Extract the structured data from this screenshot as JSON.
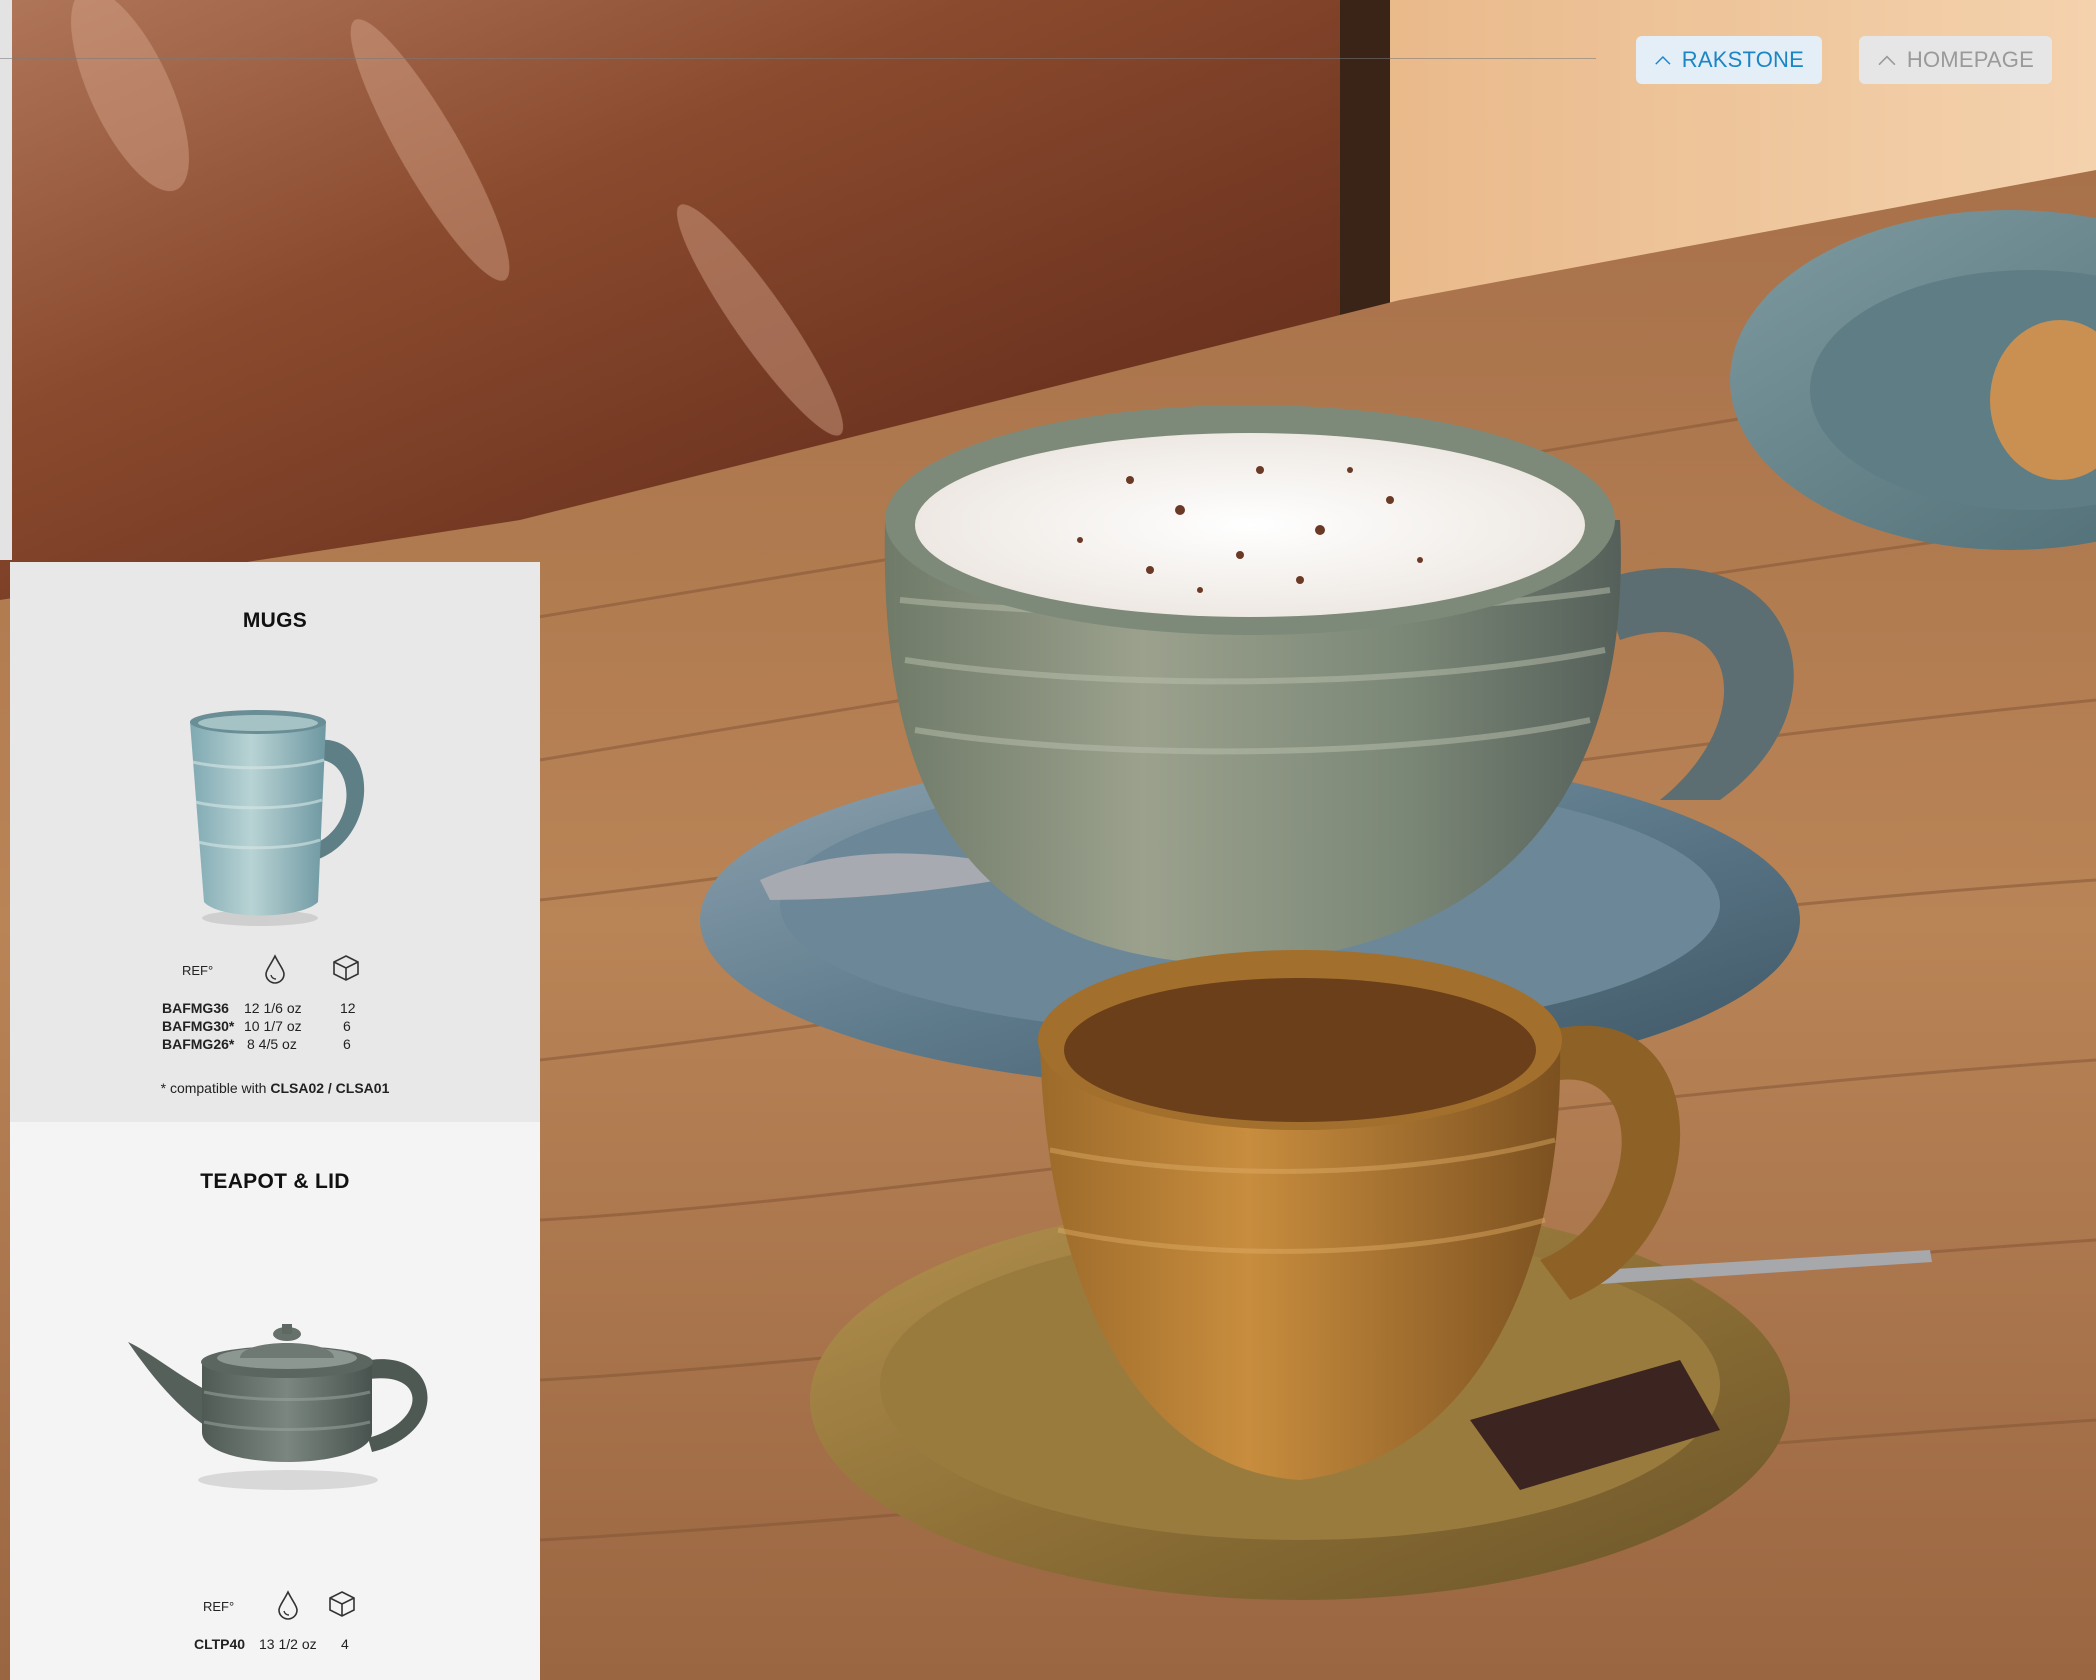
{
  "nav": {
    "rakstone_label": "RAKSTONE",
    "homepage_label": "HOMEPAGE",
    "arrow_icon": "chevron-up-icon"
  },
  "colors": {
    "accent": "#1a86c7",
    "muted": "#9a9a9a"
  },
  "mugs": {
    "title": "MUGS",
    "ref_label": "REF°",
    "capacity_icon": "drop-icon",
    "pack_icon": "box-icon",
    "rows": [
      {
        "code": "BAFMG36",
        "capacity": "12 1/6 oz",
        "qty": "12"
      },
      {
        "code": "BAFMG30*",
        "capacity": "10 1/7 oz",
        "qty": "6"
      },
      {
        "code": "BAFMG26*",
        "capacity": "8 4/5 oz",
        "qty": "6"
      }
    ],
    "note_prefix": "* compatible with ",
    "note_refs": "CLSA02 / CLSA01"
  },
  "teapot": {
    "title": "TEAPOT & LID",
    "ref_label": "REF°",
    "capacity_icon": "drop-icon",
    "pack_icon": "box-icon",
    "rows": [
      {
        "code": "CLTP40",
        "capacity": "13 1/2 oz",
        "qty": "4"
      }
    ]
  }
}
